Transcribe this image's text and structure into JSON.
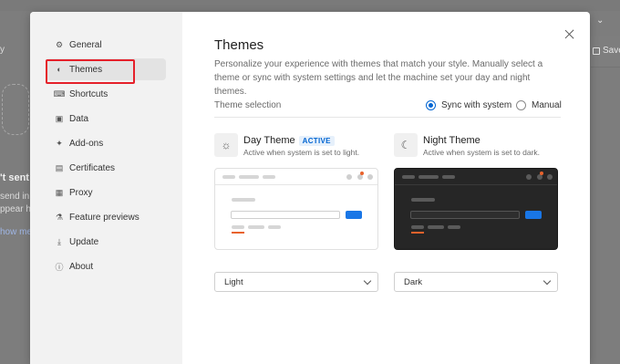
{
  "background": {
    "save_label": "Save",
    "chevron": "⌄",
    "left_fragments": [
      "y",
      "'t sent a",
      "send in",
      "ppear h",
      "how me"
    ]
  },
  "sidebar": {
    "items": [
      {
        "label": "General",
        "icon": "gear-icon",
        "glyph": "⚙"
      },
      {
        "label": "Themes",
        "icon": "palette-icon",
        "glyph": "◐"
      },
      {
        "label": "Shortcuts",
        "icon": "keyboard-icon",
        "glyph": "⌨"
      },
      {
        "label": "Data",
        "icon": "data-icon",
        "glyph": "▣"
      },
      {
        "label": "Add-ons",
        "icon": "sparkle-icon",
        "glyph": "✦"
      },
      {
        "label": "Certificates",
        "icon": "certificate-icon",
        "glyph": "▤"
      },
      {
        "label": "Proxy",
        "icon": "proxy-icon",
        "glyph": "▦"
      },
      {
        "label": "Feature previews",
        "icon": "flask-icon",
        "glyph": "⚗"
      },
      {
        "label": "Update",
        "icon": "update-icon",
        "glyph": "⤓"
      },
      {
        "label": "About",
        "icon": "info-icon",
        "glyph": "ⓘ"
      }
    ],
    "active_index": 1
  },
  "main": {
    "title": "Themes",
    "description": "Personalize your experience with themes that match your style. Manually select a theme or sync with system settings and let the machine set your day and night themes.",
    "theme_selection_label": "Theme selection",
    "options": {
      "sync": "Sync with system",
      "manual": "Manual",
      "selected": "sync"
    },
    "day": {
      "name": "Day Theme",
      "badge": "ACTIVE",
      "subtitle": "Active when system is set to light.",
      "select_value": "Light"
    },
    "night": {
      "name": "Night Theme",
      "subtitle": "Active when system is set to dark.",
      "select_value": "Dark"
    }
  },
  "colors": {
    "accent": "#0265d2",
    "highlight": "#e5202a",
    "preview_button": "#1976e6",
    "preview_accent": "#e8622c"
  }
}
